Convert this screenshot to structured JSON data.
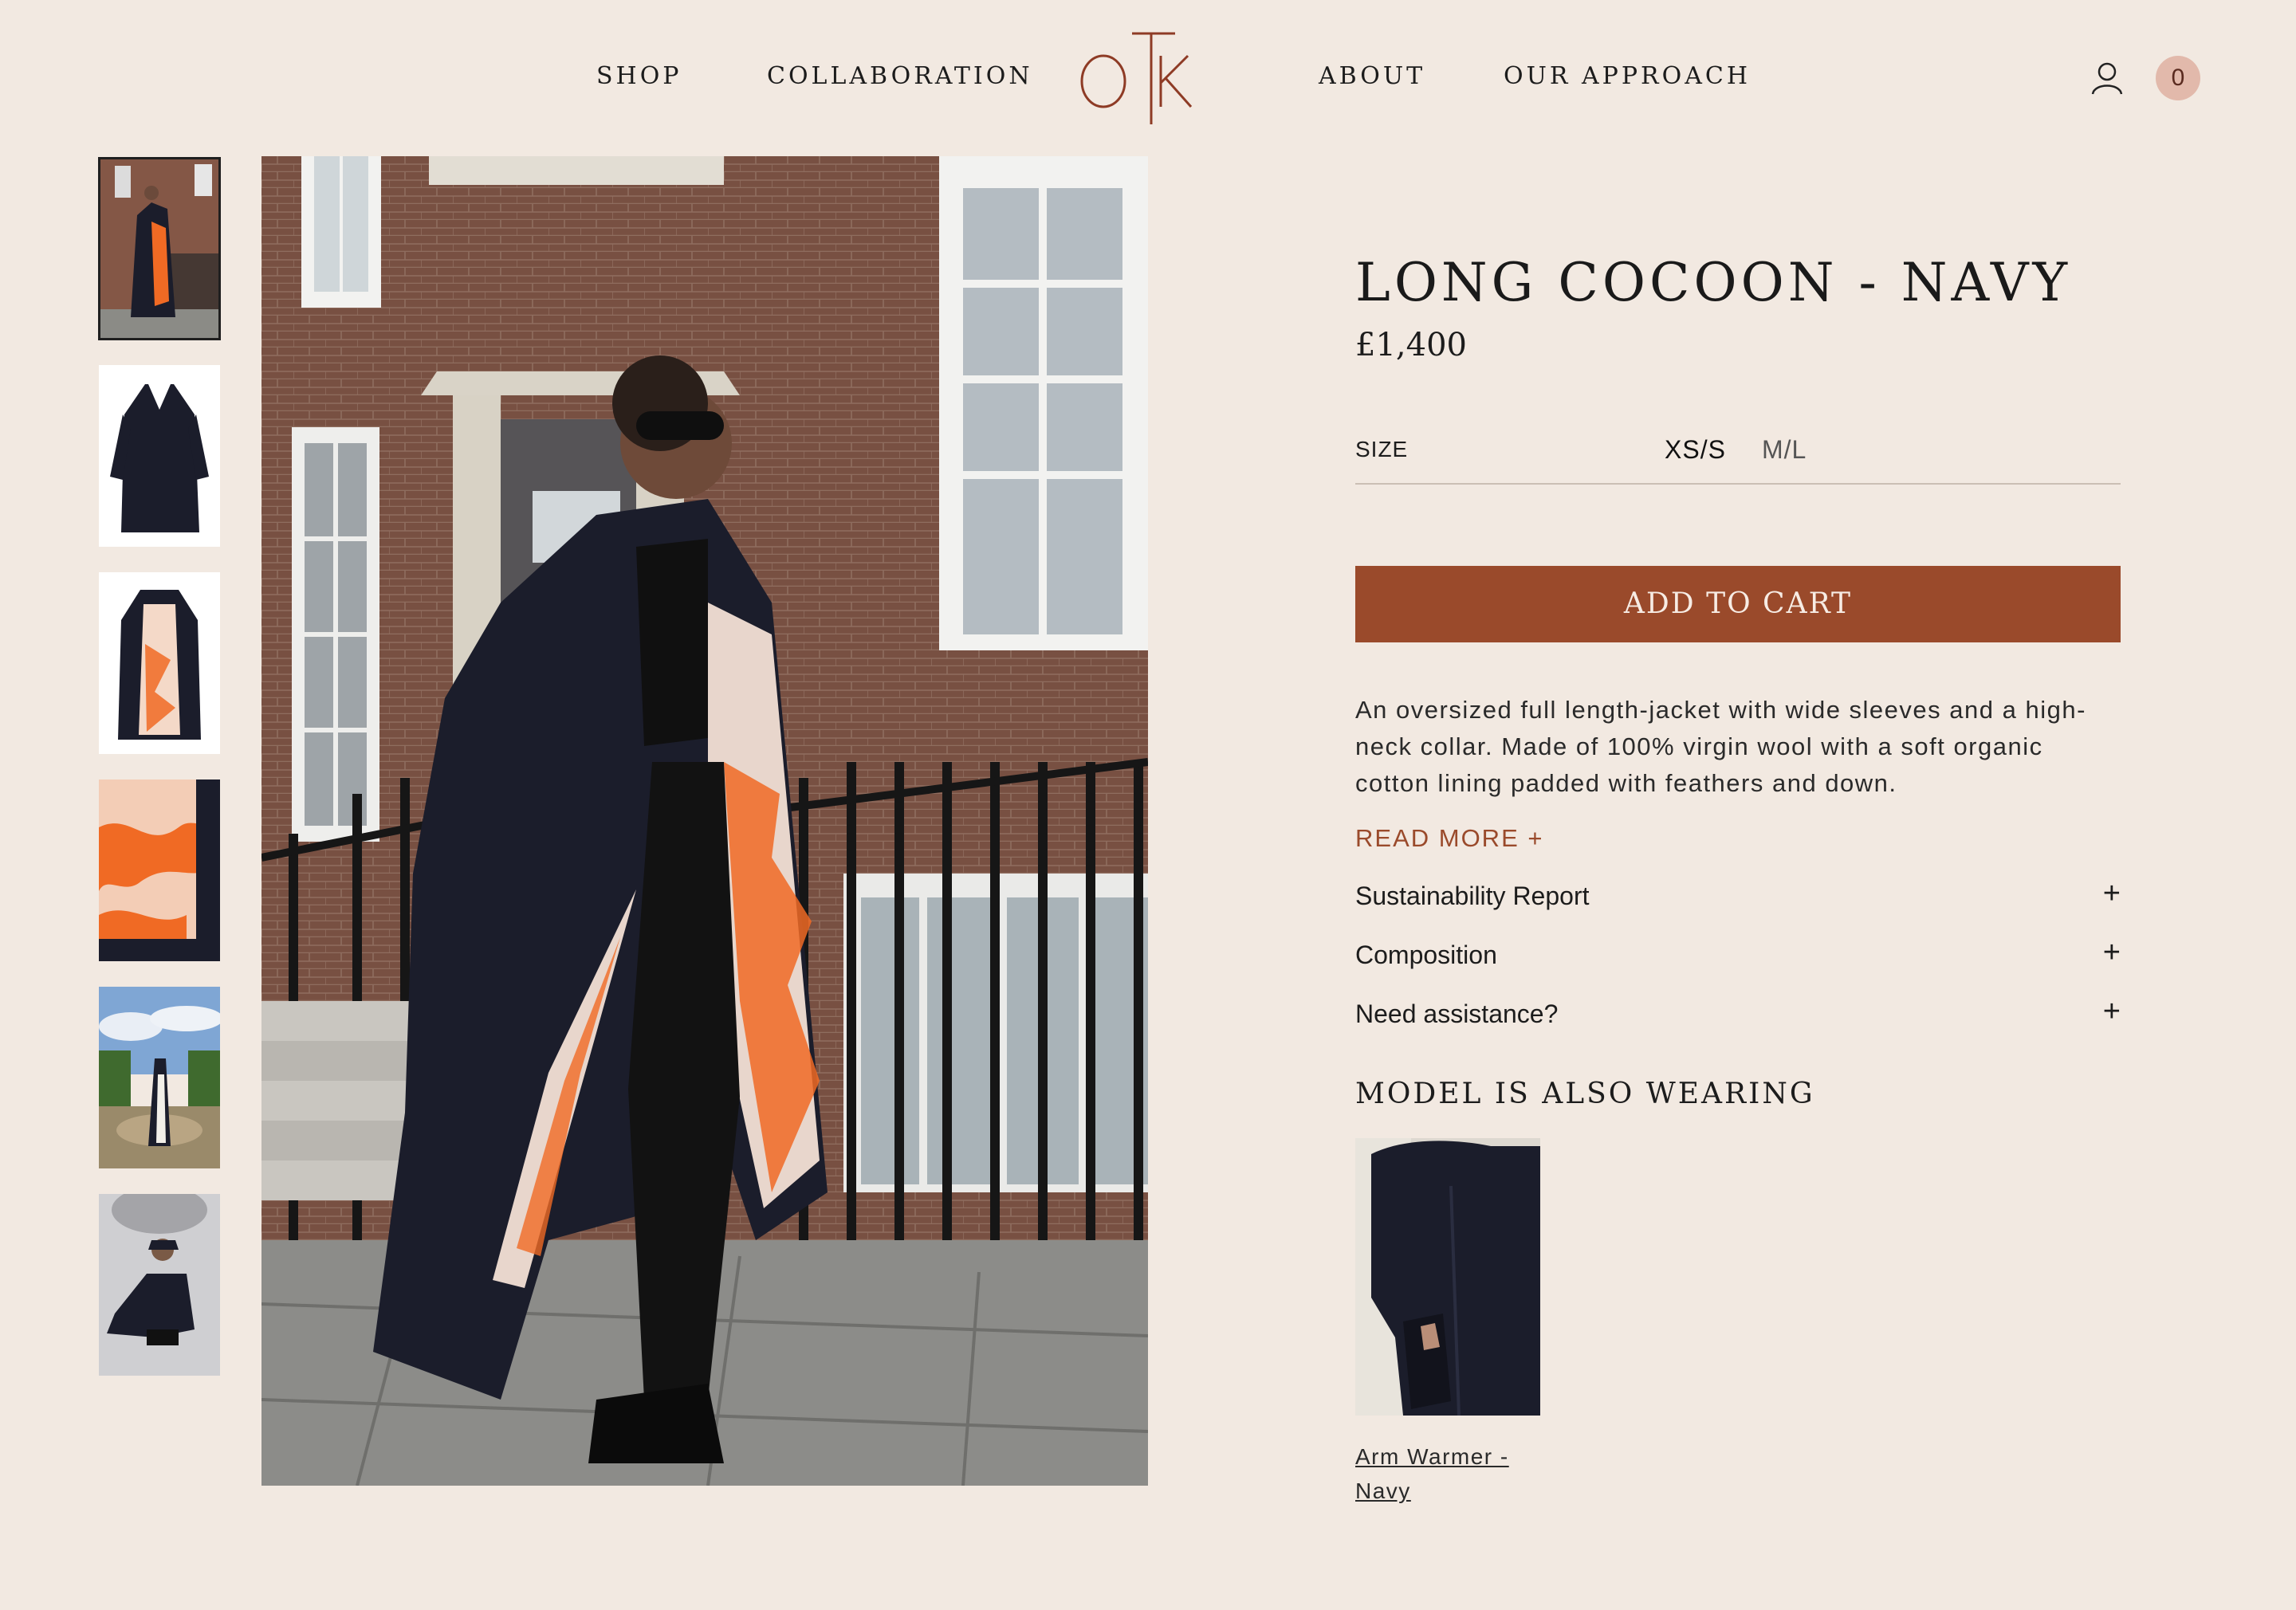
{
  "nav": {
    "links": [
      "SHOP",
      "COLLABORATION",
      "ABOUT",
      "OUR APPROACH"
    ],
    "logo": "OTK",
    "cart_count": "0"
  },
  "product": {
    "title": "LONG COCOON - NAVY",
    "price": "£1,400",
    "size_label": "SIZE",
    "sizes": [
      "XS/S",
      "M/L"
    ],
    "selected_size": "XS/S",
    "add_to_cart": "ADD TO CART",
    "description": "An oversized full length-jacket with wide sleeves and a high-neck collar. Made of 100% virgin wool with a soft organic cotton lining padded with feathers and down.",
    "read_more": "READ MORE +",
    "accordions": [
      {
        "label": "Sustainability Report",
        "icon": "+"
      },
      {
        "label": "Composition",
        "icon": "+"
      },
      {
        "label": "Need assistance?",
        "icon": "+"
      }
    ]
  },
  "also_wearing": {
    "title": "MODEL IS ALSO WEARING",
    "items": [
      {
        "name": "Arm Warmer - Navy"
      }
    ]
  },
  "colors": {
    "background": "#f2e9e1",
    "accent": "#9a4a2b",
    "cart_badge": "#e2b9ab",
    "coat_navy": "#1b1d2b",
    "lining_orange": "#f06a24"
  }
}
